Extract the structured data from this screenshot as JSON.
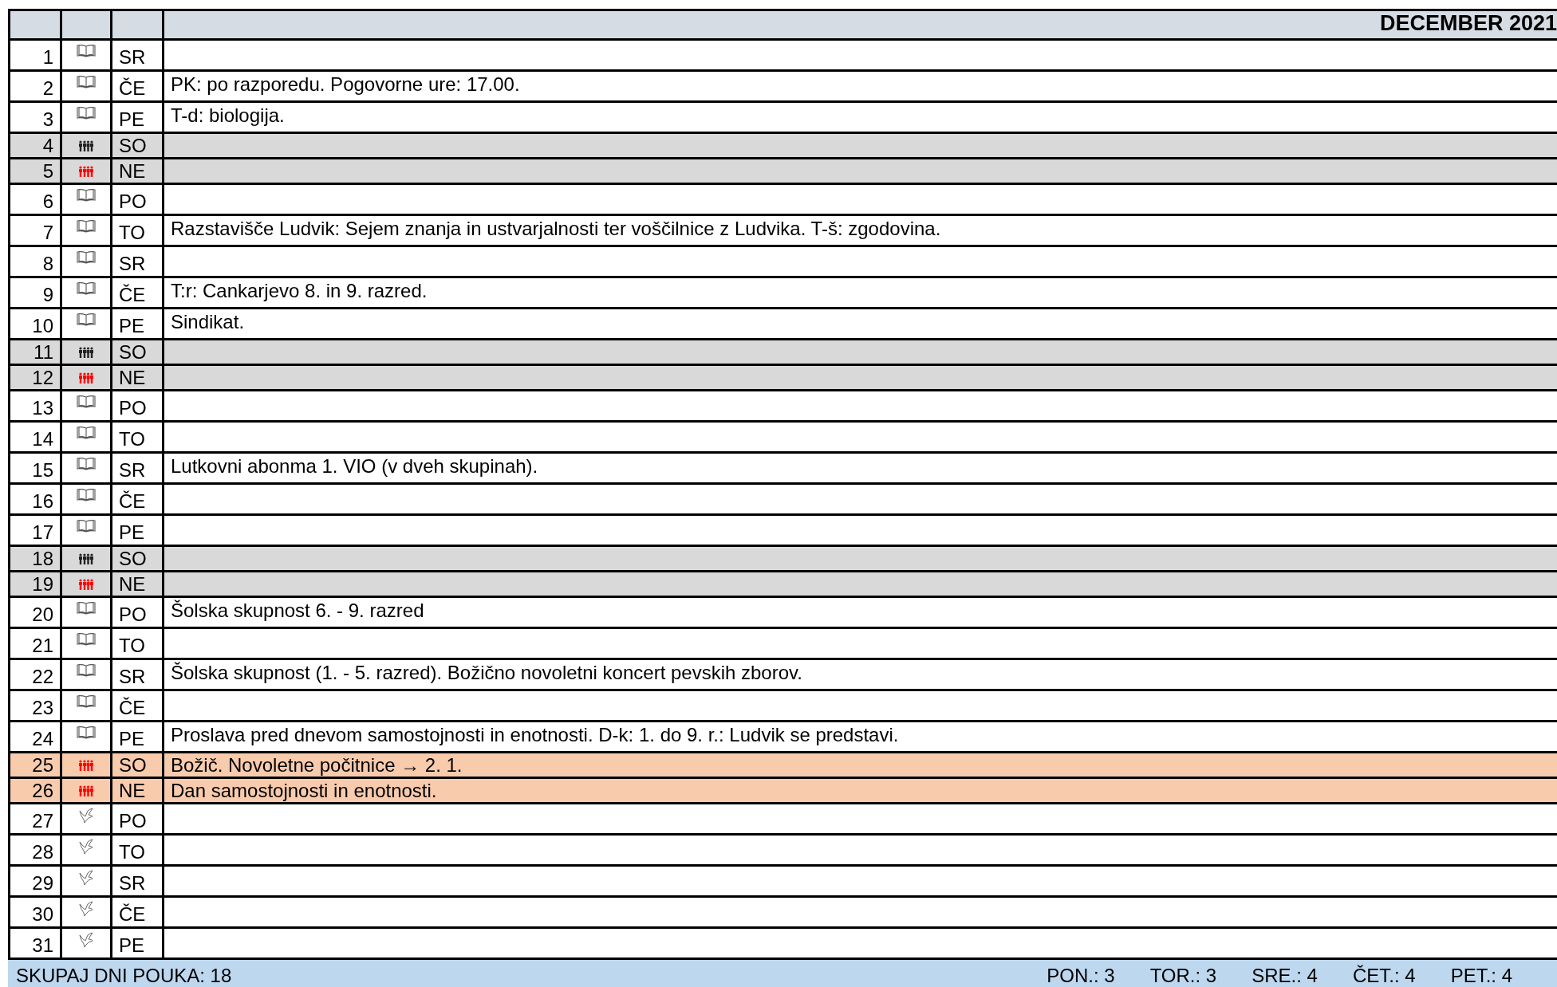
{
  "title": "DECEMBER 2021",
  "rows": [
    {
      "day": "1",
      "weekday": "SR",
      "kind": "school"
    },
    {
      "day": "2",
      "weekday": "ČE",
      "kind": "school",
      "note": "PK: po razporedu. Pogovorne ure: 17.00."
    },
    {
      "day": "3",
      "weekday": "PE",
      "kind": "school",
      "note": "T-d: biologija."
    },
    {
      "day": "4",
      "weekday": "SO",
      "kind": "saturday"
    },
    {
      "day": "5",
      "weekday": "NE",
      "kind": "sunday"
    },
    {
      "day": "6",
      "weekday": "PO",
      "kind": "school"
    },
    {
      "day": "7",
      "weekday": "TO",
      "kind": "school",
      "note": "Razstavišče Ludvik: Sejem znanja in ustvarjalnosti ter voščilnice z Ludvika. T-š: zgodovina."
    },
    {
      "day": "8",
      "weekday": "SR",
      "kind": "school"
    },
    {
      "day": "9",
      "weekday": "ČE",
      "kind": "school",
      "note": "T:r: Cankarjevo 8. in 9. razred."
    },
    {
      "day": "10",
      "weekday": "PE",
      "kind": "school",
      "note": "Sindikat."
    },
    {
      "day": "11",
      "weekday": "SO",
      "kind": "saturday"
    },
    {
      "day": "12",
      "weekday": "NE",
      "kind": "sunday"
    },
    {
      "day": "13",
      "weekday": "PO",
      "kind": "school"
    },
    {
      "day": "14",
      "weekday": "TO",
      "kind": "school"
    },
    {
      "day": "15",
      "weekday": "SR",
      "kind": "school",
      "note": "Lutkovni abonma 1. VIO (v dveh skupinah)."
    },
    {
      "day": "16",
      "weekday": "ČE",
      "kind": "school"
    },
    {
      "day": "17",
      "weekday": "PE",
      "kind": "school"
    },
    {
      "day": "18",
      "weekday": "SO",
      "kind": "saturday"
    },
    {
      "day": "19",
      "weekday": "NE",
      "kind": "sunday"
    },
    {
      "day": "20",
      "weekday": "PO",
      "kind": "school",
      "note": "Šolska skupnost 6. - 9. razred"
    },
    {
      "day": "21",
      "weekday": "TO",
      "kind": "school"
    },
    {
      "day": "22",
      "weekday": "SR",
      "kind": "school",
      "note": "Šolska skupnost (1. - 5. razred). Božično novoletni koncert pevskih zborov."
    },
    {
      "day": "23",
      "weekday": "ČE",
      "kind": "school"
    },
    {
      "day": "24",
      "weekday": "PE",
      "kind": "school",
      "note": "Proslava pred dnevom samostojnosti in enotnosti. D-k: 1. do 9. r.: Ludvik se predstavi."
    },
    {
      "day": "25",
      "weekday": "SO",
      "kind": "holiday",
      "note": "Božič. Novoletne počitnice  → 2. 1."
    },
    {
      "day": "26",
      "weekday": "NE",
      "kind": "holiday",
      "note": "Dan samostojnosti in enotnosti."
    },
    {
      "day": "27",
      "weekday": "PO",
      "kind": "vacation"
    },
    {
      "day": "28",
      "weekday": "TO",
      "kind": "vacation"
    },
    {
      "day": "29",
      "weekday": "SR",
      "kind": "vacation"
    },
    {
      "day": "30",
      "weekday": "ČE",
      "kind": "vacation"
    },
    {
      "day": "31",
      "weekday": "PE",
      "kind": "vacation"
    }
  ],
  "footer": {
    "total": "SKUPAJ DNI POUKA: 18",
    "counts": [
      "PON.: 3",
      "TOR.: 3",
      "SRE.: 4",
      "ČET.: 4",
      "PET.: 4"
    ]
  }
}
